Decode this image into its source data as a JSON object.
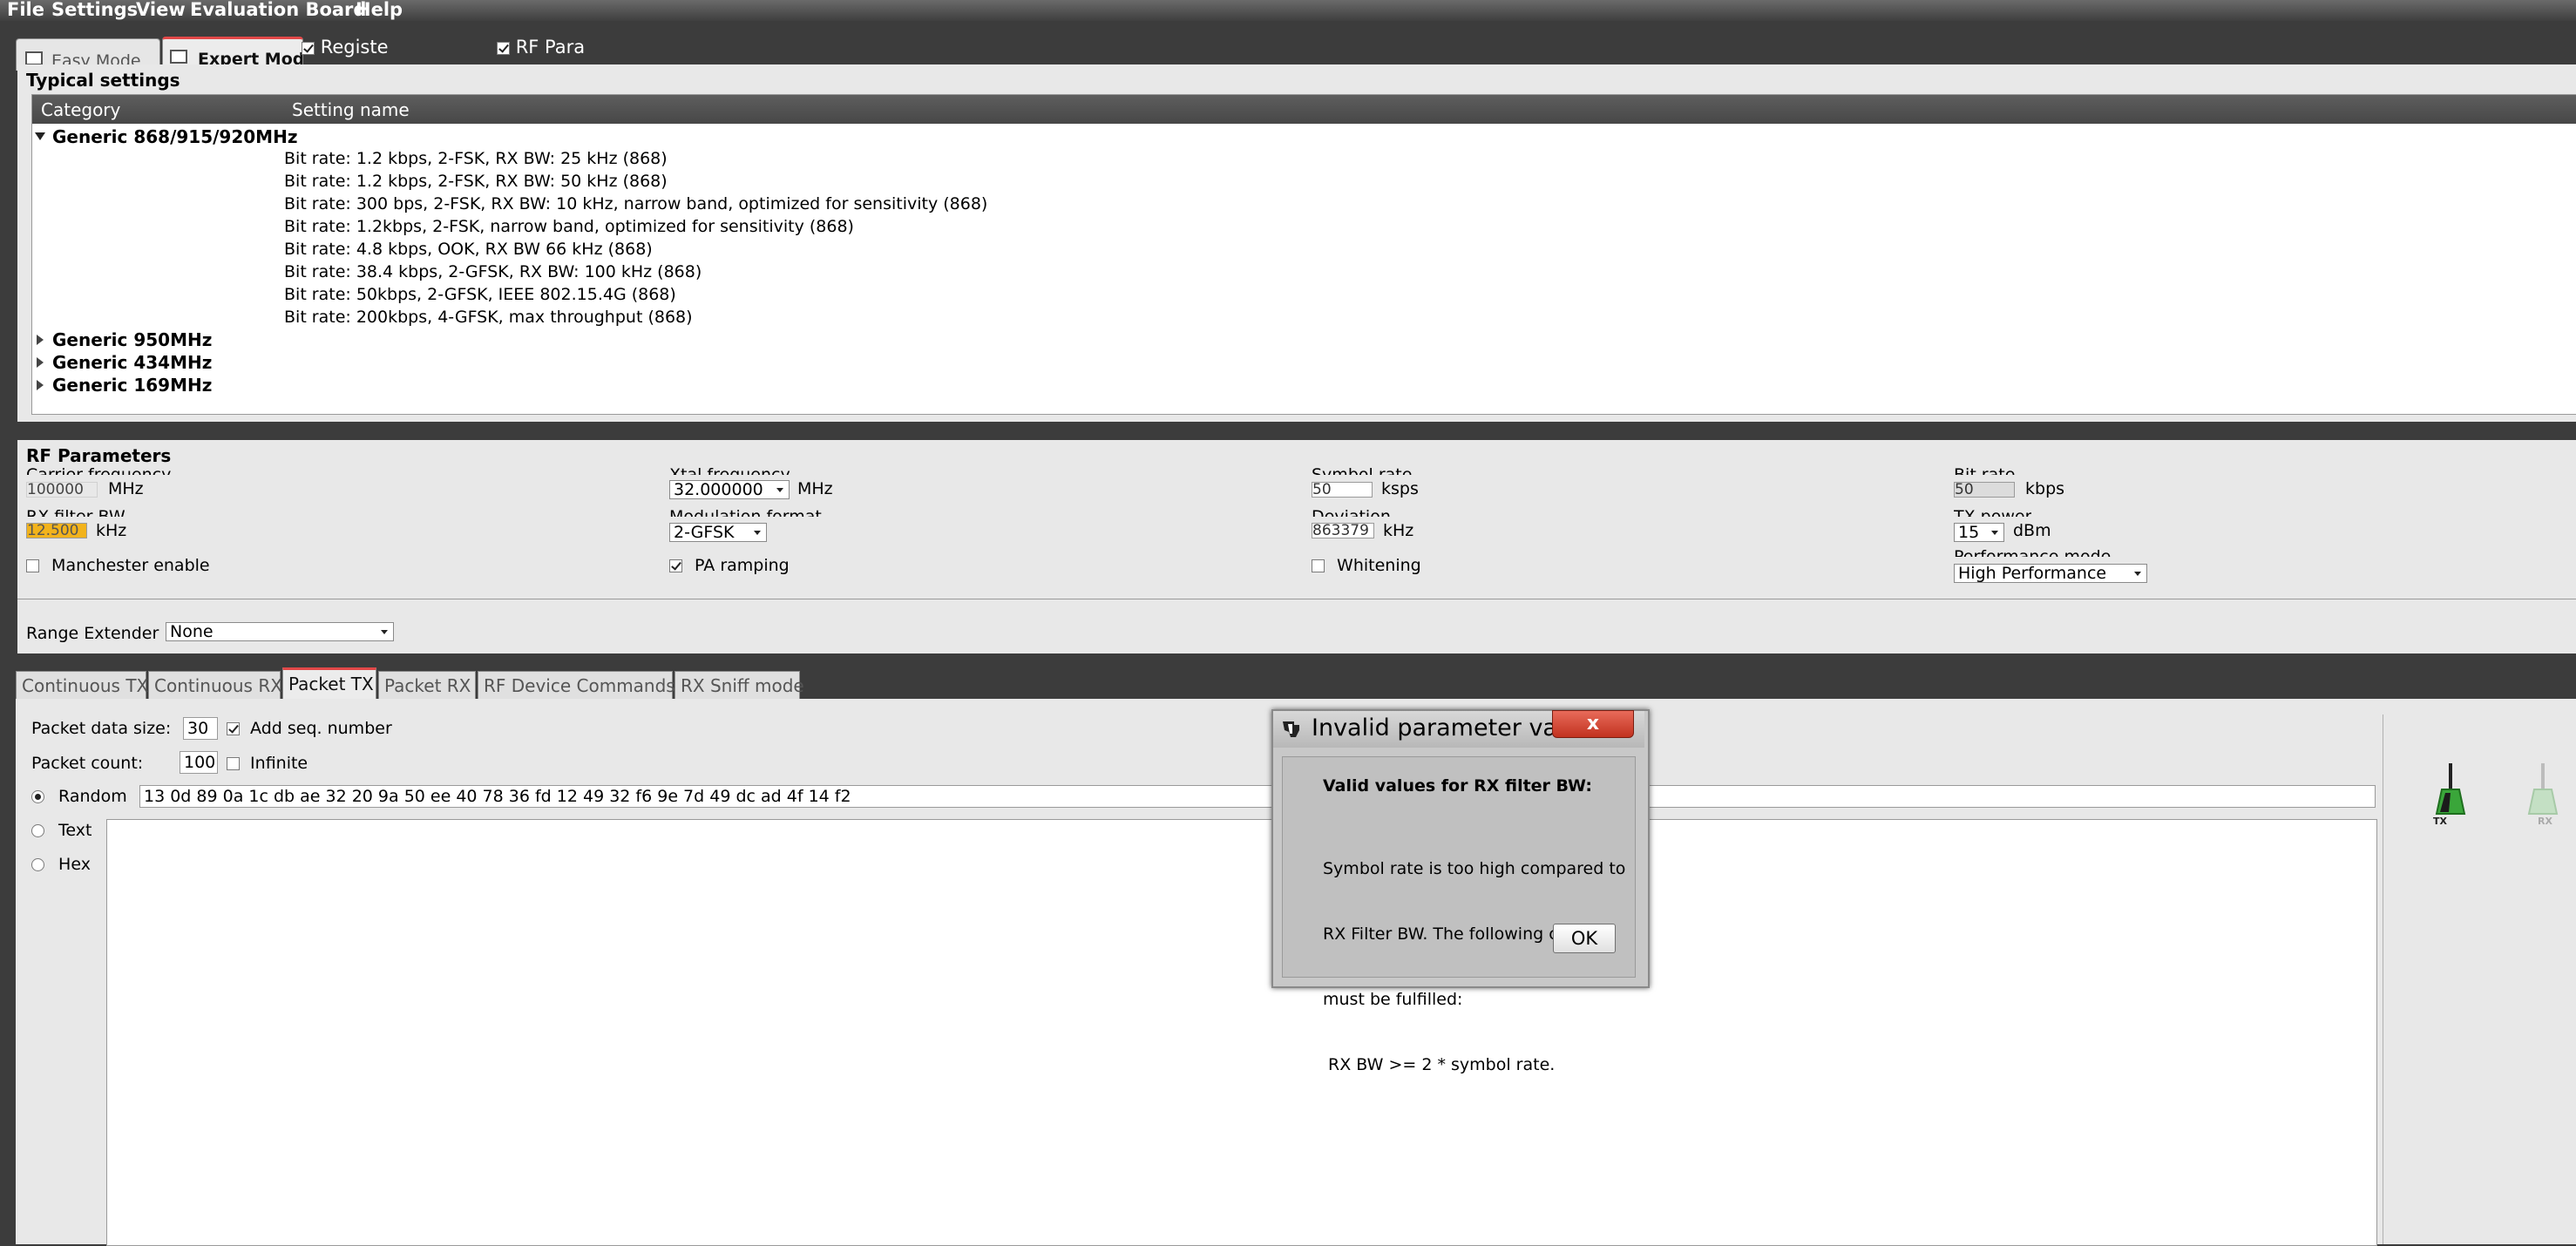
{
  "menu": [
    "File",
    "Settings",
    "View",
    "Evaluation Board",
    "Help"
  ],
  "mode_tabs": {
    "easy": "Easy Mode",
    "expert": "Expert Mode"
  },
  "header_checks": [
    {
      "label": "Registe",
      "checked": true
    },
    {
      "label": "RF Para",
      "checked": true
    }
  ],
  "typical": {
    "title": "Typical settings",
    "columns": [
      "Category",
      "Setting name"
    ],
    "groups": [
      {
        "name": "Generic 868/915/920MHz",
        "expanded": true
      },
      {
        "name": "Generic 950MHz",
        "expanded": false
      },
      {
        "name": "Generic 434MHz",
        "expanded": false
      },
      {
        "name": "Generic 169MHz",
        "expanded": false
      }
    ],
    "settings": [
      "Bit rate: 1.2 kbps, 2-FSK, RX BW: 25 kHz (868)",
      "Bit rate: 1.2 kbps, 2-FSK, RX BW: 50 kHz (868)",
      "Bit rate: 300 bps, 2-FSK, RX BW: 10 kHz, narrow band, optimized for sensitivity (868)",
      "Bit rate: 1.2kbps, 2-FSK, narrow band, optimized for sensitivity (868)",
      "Bit rate: 4.8 kbps, OOK, RX BW 66 kHz (868)",
      "Bit rate: 38.4 kbps, 2-GFSK, RX BW: 100 kHz (868)",
      "Bit rate: 50kbps, 2-GFSK, IEEE 802.15.4G (868)",
      "Bit rate: 200kbps, 4-GFSK, max throughput (868)"
    ]
  },
  "rf": {
    "title": "RF Parameters",
    "carrier": {
      "label": "Carrier frequency",
      "value": "100000",
      "unit": "MHz"
    },
    "xtal": {
      "label": "Xtal frequency",
      "value": "32.000000",
      "unit": "MHz"
    },
    "symbol": {
      "label": "Symbol rate",
      "value": "50",
      "unit": "ksps"
    },
    "bitrate": {
      "label": "Bit rate",
      "value": "50",
      "unit": "kbps"
    },
    "rxbw": {
      "label": "RX filter BW",
      "value": "12.500",
      "unit": "kHz"
    },
    "modulation": {
      "label": "Modulation format",
      "value": "2-GFSK"
    },
    "deviation": {
      "label": "Deviation",
      "value": "863379",
      "unit": "kHz"
    },
    "txpower": {
      "label": "TX power",
      "value": "15",
      "unit": "dBm"
    },
    "manchester": {
      "label": "Manchester enable",
      "checked": false
    },
    "paramp": {
      "label": "PA ramping",
      "checked": true
    },
    "whitening": {
      "label": "Whitening",
      "checked": false
    },
    "perf": {
      "label": "Performance mode",
      "value": "High Performance"
    },
    "range": {
      "label": "Range Extender",
      "value": "None"
    }
  },
  "tabs": [
    "Continuous TX",
    "Continuous RX",
    "Packet TX",
    "Packet RX",
    "RF Device Commands",
    "RX Sniff mode"
  ],
  "selected_tab": "Packet TX",
  "packet": {
    "size_label": "Packet data size:",
    "size_value": "30",
    "seq_label": "Add seq. number",
    "seq_checked": true,
    "count_label": "Packet count:",
    "count_value": "100",
    "infinite_label": "Infinite",
    "infinite_checked": false,
    "modes": [
      {
        "label": "Random",
        "selected": true
      },
      {
        "label": "Text",
        "selected": false
      },
      {
        "label": "Hex",
        "selected": false
      }
    ],
    "random_data": "13 0d 89 0a 1c db ae 32 20 9a 50 ee 40 78 36 fd 12 49 32 f6 9e 7d 49 dc ad 4f 14 f2"
  },
  "dialog": {
    "title": "Invalid parameter val...",
    "close": "x",
    "heading": "Valid values for RX filter BW:",
    "message": [
      "Symbol rate is too high compared to",
      "RX Filter BW. The following criteria",
      "must be fulfilled:",
      " RX BW >= 2 * symbol rate."
    ],
    "ok": "OK"
  },
  "side_icons": [
    {
      "label": "TX"
    },
    {
      "label": "RX"
    }
  ],
  "colors": {
    "accent_red": "#e24848",
    "warn_field": "#f2b31c",
    "tx_green": "#3aa63a"
  }
}
